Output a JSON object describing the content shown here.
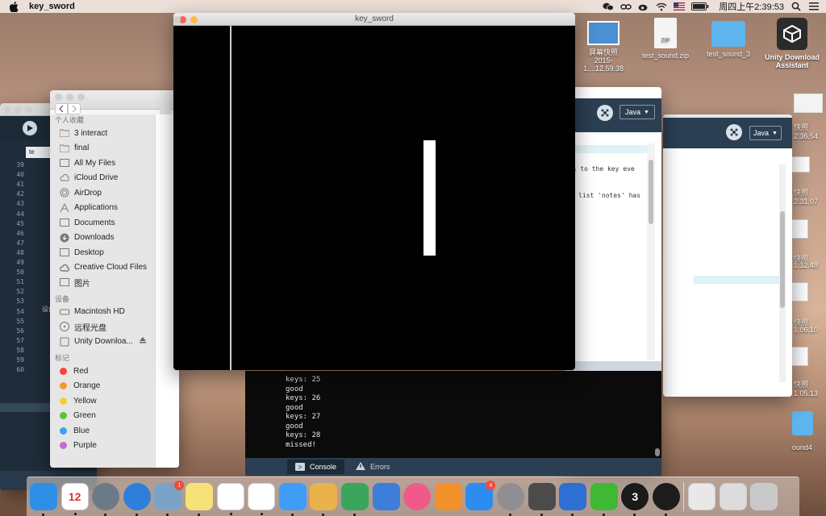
{
  "menubar": {
    "app_name": "key_sword",
    "clock": "周四上午2:39:53",
    "icons": [
      "wechat-icon",
      "link-icon",
      "weibo-icon",
      "wifi-icon",
      "us-flag-icon",
      "battery-icon",
      "search-icon",
      "list-icon"
    ]
  },
  "desktop": {
    "icons": [
      {
        "name": "screenshot",
        "label": "屏幕快照\n2015-1....12.59.38"
      },
      {
        "name": "test-sound-zip",
        "label": "test_sound.zip"
      },
      {
        "name": "test-sound-3",
        "label": "test_sound_3"
      },
      {
        "name": "unity-download-assistant",
        "label": "Unity Download\nAssistant"
      }
    ],
    "right_labels": [
      "快照",
      "2.36.54",
      "快照",
      "2.31.07",
      "快照",
      "1.12.48",
      "快照",
      "1.06.10",
      "快照",
      "1.05.13",
      "ound4"
    ]
  },
  "sketch": {
    "title": "key_sword"
  },
  "finder": {
    "favorites_header": "个人收藏",
    "favorites": [
      {
        "label": "3 interact",
        "icon": "folder-icon"
      },
      {
        "label": "final",
        "icon": "folder-icon"
      },
      {
        "label": "All My Files",
        "icon": "all-files-icon"
      },
      {
        "label": "iCloud Drive",
        "icon": "cloud-icon"
      },
      {
        "label": "AirDrop",
        "icon": "airdrop-icon"
      },
      {
        "label": "Applications",
        "icon": "applications-icon"
      },
      {
        "label": "Documents",
        "icon": "documents-icon"
      },
      {
        "label": "Downloads",
        "icon": "downloads-icon"
      },
      {
        "label": "Desktop",
        "icon": "desktop-icon"
      },
      {
        "label": "Creative Cloud Files",
        "icon": "creative-cloud-icon"
      },
      {
        "label": "图片",
        "icon": "pictures-icon"
      }
    ],
    "devices_header": "设备",
    "devices": [
      {
        "label": "Macintosh HD",
        "icon": "hard-disk-icon"
      },
      {
        "label": "远程光盘",
        "icon": "remote-disc-icon"
      },
      {
        "label": "Unity Downloa...",
        "icon": "disk-image-icon"
      }
    ],
    "tags_header": "标记",
    "tags": [
      {
        "label": "Red",
        "color": "#f3453c"
      },
      {
        "label": "Orange",
        "color": "#f59a2a"
      },
      {
        "label": "Yellow",
        "color": "#f4cf2c"
      },
      {
        "label": "Green",
        "color": "#5cc03f"
      },
      {
        "label": "Blue",
        "color": "#3fa1f0"
      },
      {
        "label": "Purple",
        "color": "#c56ad6"
      }
    ]
  },
  "back_editor": {
    "line_numbers": [
      "39",
      "40",
      "41",
      "42",
      "43",
      "44",
      "45",
      "46",
      "47",
      "48",
      "49",
      "50",
      "51",
      "52",
      "53",
      "54",
      "55",
      "56",
      "57",
      "58",
      "59",
      "60"
    ],
    "side_label": "设备"
  },
  "editor": {
    "mode": "Java",
    "code_fragments": [
      "his to the key eve",
      "list 'notes' has"
    ]
  },
  "editor2": {
    "mode": "Java"
  },
  "console": {
    "lines": [
      "keys: 25",
      "good",
      "keys: 26",
      "good",
      "keys: 27",
      "good",
      "keys: 28",
      "missed!"
    ],
    "tabs": [
      {
        "label": "Console",
        "icon": "console-icon",
        "active": true
      },
      {
        "label": "Errors",
        "icon": "warning-icon",
        "active": false
      }
    ]
  },
  "dock": {
    "apps": [
      {
        "name": "finder",
        "color": "#2f8fe6"
      },
      {
        "name": "calendar",
        "color": "#ffffff",
        "text": "12"
      },
      {
        "name": "launchpad",
        "color": "#6c7a88"
      },
      {
        "name": "safari",
        "color": "#2d7fd8"
      },
      {
        "name": "mail-stamp",
        "color": "#7aa3c7",
        "badge": "1"
      },
      {
        "name": "notes",
        "color": "#f7e27a"
      },
      {
        "name": "reminders",
        "color": "#ffffff"
      },
      {
        "name": "photos",
        "color": "#ffffff"
      },
      {
        "name": "messages",
        "color": "#3f9df7"
      },
      {
        "name": "pages",
        "color": "#e9b24a"
      },
      {
        "name": "numbers",
        "color": "#3aa55d"
      },
      {
        "name": "keynote",
        "color": "#3d7ed9"
      },
      {
        "name": "itunes",
        "color": "#f05a8a"
      },
      {
        "name": "ibooks",
        "color": "#f2902a"
      },
      {
        "name": "app-store",
        "color": "#2d8cf0",
        "badge": "4"
      },
      {
        "name": "system-preferences",
        "color": "#8e8e93"
      },
      {
        "name": "sublime-text",
        "color": "#4b4b4b"
      },
      {
        "name": "teamviewer",
        "color": "#2d6fd2"
      },
      {
        "name": "wechat",
        "color": "#40b834"
      },
      {
        "name": "processing-3",
        "color": "#1a1a1a",
        "text": "3"
      },
      {
        "name": "quicktime",
        "color": "#1c1c1c"
      },
      {
        "name": "downloads-stack",
        "color": "#e8e8e8"
      },
      {
        "name": "documents-stack",
        "color": "#dcdcdc"
      },
      {
        "name": "trash",
        "color": "#c9c9c9"
      }
    ]
  }
}
